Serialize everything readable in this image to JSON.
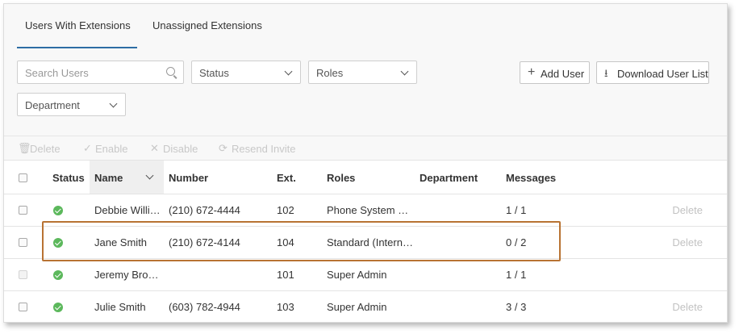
{
  "tabs": [
    {
      "label": "Users With Extensions",
      "active": true
    },
    {
      "label": "Unassigned Extensions",
      "active": false
    }
  ],
  "filters": {
    "search_placeholder": "Search Users",
    "status_label": "Status",
    "roles_label": "Roles",
    "department_label": "Department"
  },
  "actions": {
    "add_user": "Add User",
    "download": "Download User List"
  },
  "bulk": {
    "delete": "Delete",
    "enable": "Enable",
    "disable": "Disable",
    "resend": "Resend Invite"
  },
  "columns": {
    "status": "Status",
    "name": "Name",
    "number": "Number",
    "ext": "Ext.",
    "roles": "Roles",
    "department": "Department",
    "messages": "Messages"
  },
  "rows": [
    {
      "name": "Debbie Willi…",
      "number": "(210) 672-4444",
      "ext": "102",
      "roles": "Phone System …",
      "department": "",
      "messages": "1 / 1",
      "delete": "Delete",
      "selectable": true
    },
    {
      "name": "Jane Smith",
      "number": "(210) 672-4144",
      "ext": "104",
      "roles": "Standard (Intern…",
      "department": "",
      "messages": "0 / 2",
      "delete": "Delete",
      "selectable": true
    },
    {
      "name": "Jeremy Bro…",
      "number": "",
      "ext": "101",
      "roles": "Super Admin",
      "department": "",
      "messages": "1 / 1",
      "delete": "",
      "selectable": false
    },
    {
      "name": "Julie Smith",
      "number": "(603) 782-4944",
      "ext": "103",
      "roles": "Super Admin",
      "department": "",
      "messages": "3 / 3",
      "delete": "Delete",
      "selectable": true
    }
  ],
  "colors": {
    "status_ok": "#5cb85c",
    "tab_underline": "#2e6da4",
    "highlight_border": "#b87333"
  }
}
